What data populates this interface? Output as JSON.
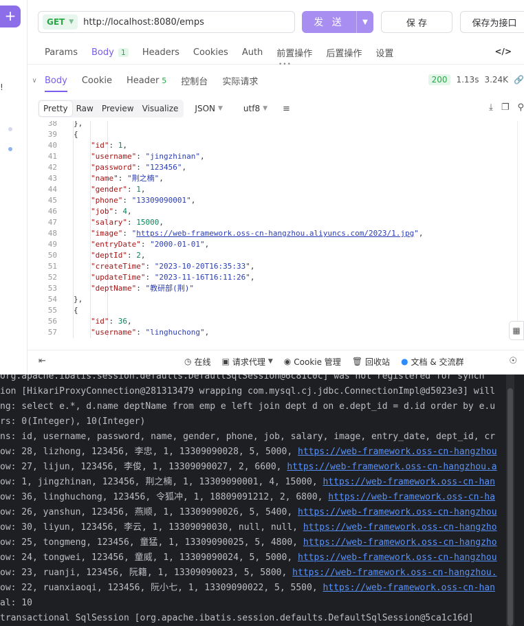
{
  "left_strip": {
    "plus": "+",
    "mark": "!"
  },
  "request": {
    "method": "GET",
    "url": "http://localhost:8080/emps",
    "send_label": "发 送",
    "save_label": "保 存",
    "save_as_label": "保存为接口"
  },
  "request_tabs": [
    {
      "label": "Params"
    },
    {
      "label": "Body",
      "count": "1",
      "active": true
    },
    {
      "label": "Headers"
    },
    {
      "label": "Cookies"
    },
    {
      "label": "Auth"
    },
    {
      "label": "前置操作"
    },
    {
      "label": "后置操作"
    },
    {
      "label": "设置"
    }
  ],
  "response_tabs": [
    {
      "label": "Body",
      "active": true
    },
    {
      "label": "Cookie"
    },
    {
      "label": "Header",
      "count": "5"
    },
    {
      "label": "控制台"
    },
    {
      "label": "实际请求"
    }
  ],
  "response_meta": {
    "status": "200",
    "time": "1.13s",
    "size": "3.24K"
  },
  "view_modes": [
    "Pretty",
    "Raw",
    "Preview",
    "Visualize"
  ],
  "active_view": "Pretty",
  "format": "JSON",
  "encoding": "utf8",
  "code_lines": [
    {
      "n": "38",
      "indent": 3,
      "t": [
        [
          "p",
          "},"
        ]
      ]
    },
    {
      "n": "39",
      "indent": 3,
      "t": [
        [
          "p",
          "{"
        ]
      ]
    },
    {
      "n": "40",
      "indent": 4,
      "t": [
        [
          "k",
          "\"id\""
        ],
        [
          "p",
          ": "
        ],
        [
          "n",
          "1"
        ],
        [
          "p",
          ","
        ]
      ]
    },
    {
      "n": "41",
      "indent": 4,
      "t": [
        [
          "k",
          "\"username\""
        ],
        [
          "p",
          ": "
        ],
        [
          "s",
          "\"jingzhinan\""
        ],
        [
          "p",
          ","
        ]
      ]
    },
    {
      "n": "42",
      "indent": 4,
      "t": [
        [
          "k",
          "\"password\""
        ],
        [
          "p",
          ": "
        ],
        [
          "s",
          "\"123456\""
        ],
        [
          "p",
          ","
        ]
      ]
    },
    {
      "n": "43",
      "indent": 4,
      "t": [
        [
          "k",
          "\"name\""
        ],
        [
          "p",
          ": "
        ],
        [
          "s",
          "\"荆之楠\""
        ],
        [
          "p",
          ","
        ]
      ]
    },
    {
      "n": "44",
      "indent": 4,
      "t": [
        [
          "k",
          "\"gender\""
        ],
        [
          "p",
          ": "
        ],
        [
          "n",
          "1"
        ],
        [
          "p",
          ","
        ]
      ]
    },
    {
      "n": "45",
      "indent": 4,
      "t": [
        [
          "k",
          "\"phone\""
        ],
        [
          "p",
          ": "
        ],
        [
          "s",
          "\"13309090001\""
        ],
        [
          "p",
          ","
        ]
      ]
    },
    {
      "n": "46",
      "indent": 4,
      "t": [
        [
          "k",
          "\"job\""
        ],
        [
          "p",
          ": "
        ],
        [
          "n",
          "4"
        ],
        [
          "p",
          ","
        ]
      ]
    },
    {
      "n": "47",
      "indent": 4,
      "t": [
        [
          "k",
          "\"salary\""
        ],
        [
          "p",
          ": "
        ],
        [
          "n",
          "15000"
        ],
        [
          "p",
          ","
        ]
      ]
    },
    {
      "n": "48",
      "indent": 4,
      "t": [
        [
          "k",
          "\"image\""
        ],
        [
          "p",
          ": "
        ],
        [
          "s",
          "\""
        ],
        [
          "lnk",
          "https://web-framework.oss-cn-hangzhou.aliyuncs.com/2023/1.jpg"
        ],
        [
          "s",
          "\""
        ],
        [
          "p",
          ","
        ]
      ]
    },
    {
      "n": "49",
      "indent": 4,
      "t": [
        [
          "k",
          "\"entryDate\""
        ],
        [
          "p",
          ": "
        ],
        [
          "s",
          "\"2000-01-01\""
        ],
        [
          "p",
          ","
        ]
      ]
    },
    {
      "n": "50",
      "indent": 4,
      "t": [
        [
          "k",
          "\"deptId\""
        ],
        [
          "p",
          ": "
        ],
        [
          "n",
          "2"
        ],
        [
          "p",
          ","
        ]
      ]
    },
    {
      "n": "51",
      "indent": 4,
      "t": [
        [
          "k",
          "\"createTime\""
        ],
        [
          "p",
          ": "
        ],
        [
          "s",
          "\"2023-10-20T16:35:33\""
        ],
        [
          "p",
          ","
        ]
      ]
    },
    {
      "n": "52",
      "indent": 4,
      "t": [
        [
          "k",
          "\"updateTime\""
        ],
        [
          "p",
          ": "
        ],
        [
          "s",
          "\"2023-11-16T16:11:26\""
        ],
        [
          "p",
          ","
        ]
      ]
    },
    {
      "n": "53",
      "indent": 4,
      "t": [
        [
          "k",
          "\"deptName\""
        ],
        [
          "p",
          ": "
        ],
        [
          "s",
          "\"教研部(荆)\""
        ]
      ]
    },
    {
      "n": "54",
      "indent": 3,
      "t": [
        [
          "p",
          "},"
        ]
      ]
    },
    {
      "n": "55",
      "indent": 3,
      "t": [
        [
          "p",
          "{"
        ]
      ]
    },
    {
      "n": "56",
      "indent": 4,
      "t": [
        [
          "k",
          "\"id\""
        ],
        [
          "p",
          ": "
        ],
        [
          "n",
          "36"
        ],
        [
          "p",
          ","
        ]
      ]
    },
    {
      "n": "57",
      "indent": 4,
      "t": [
        [
          "k",
          "\"username\""
        ],
        [
          "p",
          ": "
        ],
        [
          "s",
          "\"linghuchong\""
        ],
        [
          "p",
          ","
        ]
      ]
    }
  ],
  "bottom_bar": {
    "online": "在线",
    "proxy": "请求代理",
    "cookie": "Cookie 管理",
    "recycle": "回收站",
    "docs": "文档 & 交流群"
  },
  "console_lines": [
    {
      "text": "org.apache.ibatis.session.defaults.DefaultSqlSession@6c81c0c] was not registered for synch"
    },
    {
      "text": "ion [HikariProxyConnection@281313479 wrapping com.mysql.cj.jdbc.ConnectionImpl@d5023e3] will"
    },
    {
      "text": "ng: select e.*, d.name deptName from emp e left join dept d on e.dept_id = d.id order by e.u"
    },
    {
      "text": "rs: 0(Integer), 10(Integer)"
    },
    {
      "text": "ns: id, username, password, name, gender, phone, job, salary, image, entry_date, dept_id, cr"
    },
    {
      "text": "ow: 28, lizhong, 123456, 李忠, 1, 13309090028, 5, 5000, ",
      "url": "https://web-framework.oss-cn-hangzhou"
    },
    {
      "text": "ow: 27, lijun, 123456, 李俊, 1, 13309090027, 2, 6600, ",
      "url": "https://web-framework.oss-cn-hangzhou.a"
    },
    {
      "text": "ow: 1, jingzhinan, 123456, 荆之楠, 1, 13309090001, 4, 15000, ",
      "url": "https://web-framework.oss-cn-han"
    },
    {
      "text": "ow: 36, linghuchong, 123456, 令狐冲, 1, 18809091212, 2, 6800, ",
      "url": "https://web-framework.oss-cn-ha"
    },
    {
      "text": "ow: 26, yanshun, 123456, 燕顺, 1, 13309090026, 5, 5400, ",
      "url": "https://web-framework.oss-cn-hangzhou"
    },
    {
      "text": "ow: 30, liyun, 123456, 李云, 1, 13309090030, null, null, ",
      "url": "https://web-framework.oss-cn-hangzho"
    },
    {
      "text": "ow: 25, tongmeng, 123456, 童猛, 1, 13309090025, 5, 4800, ",
      "url": "https://web-framework.oss-cn-hangzho"
    },
    {
      "text": "ow: 24, tongwei, 123456, 童威, 1, 13309090024, 5, 5000, ",
      "url": "https://web-framework.oss-cn-hangzhou"
    },
    {
      "text": "ow: 23, ruanji, 123456, 阮籍, 1, 13309090023, 5, 5800, ",
      "url": "https://web-framework.oss-cn-hangzhou."
    },
    {
      "text": "ow: 22, ruanxiaoqi, 123456, 阮小七, 1, 13309090022, 5, 5500, ",
      "url": "https://web-framework.oss-cn-han"
    },
    {
      "text": "al: 10"
    },
    {
      "text": "transactional SqlSession [org.apache.ibatis.session.defaults.DefaultSqlSession@5ca1c16d]"
    }
  ],
  "colors": {
    "accent": "#7a5cf0",
    "send_button": "#a88ef0",
    "status_green": "#28a745",
    "console_bg": "#1e1f22",
    "console_text": "#bcbec4",
    "console_link": "#5891f8"
  },
  "icons": {
    "code": "code-icon",
    "collapse": "chevron-down-icon",
    "download": "download-icon",
    "copy": "copy-icon",
    "search": "search-icon",
    "wrap": "wrap-lines-icon",
    "link": "link-icon",
    "online": "online-status-icon",
    "proxy": "proxy-icon",
    "cookie": "cookie-icon",
    "recycle": "trash-icon",
    "docs": "community-icon",
    "help": "help-icon"
  }
}
